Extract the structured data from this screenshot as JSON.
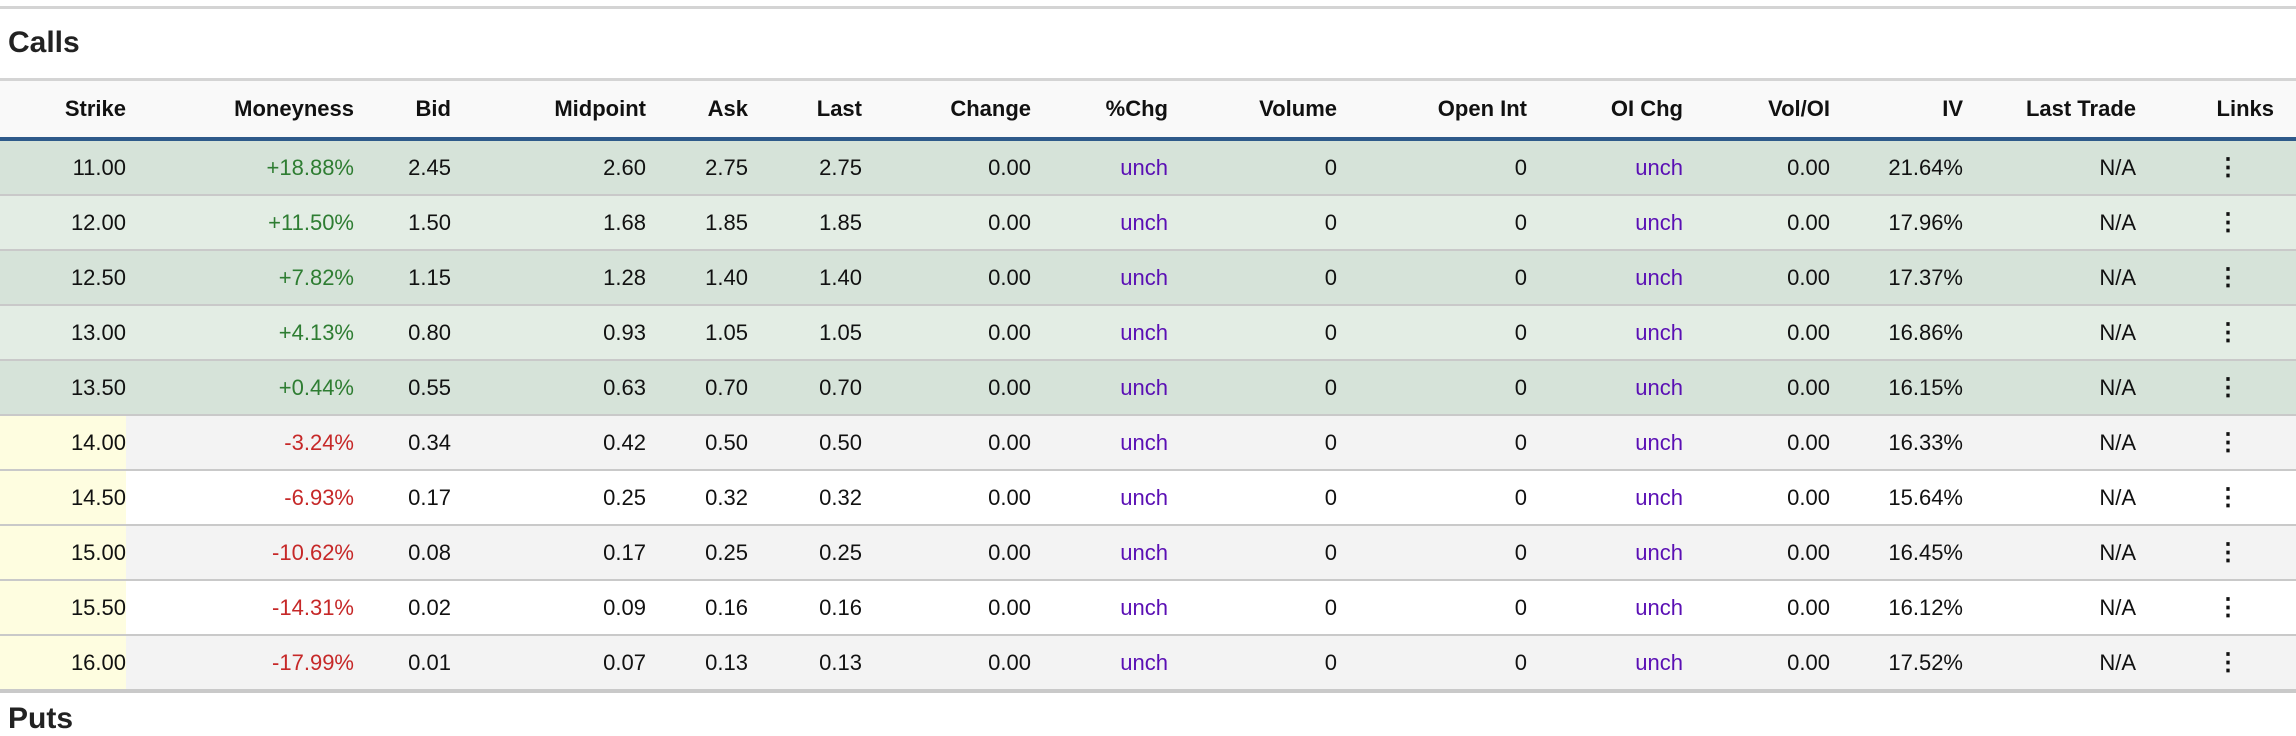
{
  "section_title": "Calls",
  "next_section_title": "Puts",
  "columns": [
    "Strike",
    "Moneyness",
    "Bid",
    "Midpoint",
    "Ask",
    "Last",
    "Change",
    "%Chg",
    "Volume",
    "Open Int",
    "OI Chg",
    "Vol/OI",
    "IV",
    "Last Trade",
    "Links"
  ],
  "rows": [
    {
      "strike": "11.00",
      "moneyness": "+18.88%",
      "bid": "2.45",
      "mid": "2.60",
      "ask": "2.75",
      "last": "2.75",
      "change": "0.00",
      "pchg": "unch",
      "volume": "0",
      "oi": "0",
      "oichg": "unch",
      "voloi": "0.00",
      "iv": "21.64%",
      "last_trade": "N/A",
      "itm": true
    },
    {
      "strike": "12.00",
      "moneyness": "+11.50%",
      "bid": "1.50",
      "mid": "1.68",
      "ask": "1.85",
      "last": "1.85",
      "change": "0.00",
      "pchg": "unch",
      "volume": "0",
      "oi": "0",
      "oichg": "unch",
      "voloi": "0.00",
      "iv": "17.96%",
      "last_trade": "N/A",
      "itm": true
    },
    {
      "strike": "12.50",
      "moneyness": "+7.82%",
      "bid": "1.15",
      "mid": "1.28",
      "ask": "1.40",
      "last": "1.40",
      "change": "0.00",
      "pchg": "unch",
      "volume": "0",
      "oi": "0",
      "oichg": "unch",
      "voloi": "0.00",
      "iv": "17.37%",
      "last_trade": "N/A",
      "itm": true
    },
    {
      "strike": "13.00",
      "moneyness": "+4.13%",
      "bid": "0.80",
      "mid": "0.93",
      "ask": "1.05",
      "last": "1.05",
      "change": "0.00",
      "pchg": "unch",
      "volume": "0",
      "oi": "0",
      "oichg": "unch",
      "voloi": "0.00",
      "iv": "16.86%",
      "last_trade": "N/A",
      "itm": true
    },
    {
      "strike": "13.50",
      "moneyness": "+0.44%",
      "bid": "0.55",
      "mid": "0.63",
      "ask": "0.70",
      "last": "0.70",
      "change": "0.00",
      "pchg": "unch",
      "volume": "0",
      "oi": "0",
      "oichg": "unch",
      "voloi": "0.00",
      "iv": "16.15%",
      "last_trade": "N/A",
      "itm": true
    },
    {
      "strike": "14.00",
      "moneyness": "-3.24%",
      "bid": "0.34",
      "mid": "0.42",
      "ask": "0.50",
      "last": "0.50",
      "change": "0.00",
      "pchg": "unch",
      "volume": "0",
      "oi": "0",
      "oichg": "unch",
      "voloi": "0.00",
      "iv": "16.33%",
      "last_trade": "N/A",
      "itm": false
    },
    {
      "strike": "14.50",
      "moneyness": "-6.93%",
      "bid": "0.17",
      "mid": "0.25",
      "ask": "0.32",
      "last": "0.32",
      "change": "0.00",
      "pchg": "unch",
      "volume": "0",
      "oi": "0",
      "oichg": "unch",
      "voloi": "0.00",
      "iv": "15.64%",
      "last_trade": "N/A",
      "itm": false
    },
    {
      "strike": "15.00",
      "moneyness": "-10.62%",
      "bid": "0.08",
      "mid": "0.17",
      "ask": "0.25",
      "last": "0.25",
      "change": "0.00",
      "pchg": "unch",
      "volume": "0",
      "oi": "0",
      "oichg": "unch",
      "voloi": "0.00",
      "iv": "16.45%",
      "last_trade": "N/A",
      "itm": false
    },
    {
      "strike": "15.50",
      "moneyness": "-14.31%",
      "bid": "0.02",
      "mid": "0.09",
      "ask": "0.16",
      "last": "0.16",
      "change": "0.00",
      "pchg": "unch",
      "volume": "0",
      "oi": "0",
      "oichg": "unch",
      "voloi": "0.00",
      "iv": "16.12%",
      "last_trade": "N/A",
      "itm": false
    },
    {
      "strike": "16.00",
      "moneyness": "-17.99%",
      "bid": "0.01",
      "mid": "0.07",
      "ask": "0.13",
      "last": "0.13",
      "change": "0.00",
      "pchg": "unch",
      "volume": "0",
      "oi": "0",
      "oichg": "unch",
      "voloi": "0.00",
      "iv": "17.52%",
      "last_trade": "N/A",
      "itm": false
    }
  ],
  "links_icon": "more-vertical-icon",
  "links_glyph": "⋮",
  "colors": {
    "header_border": "#2e5a8a",
    "positive": "#2e7d32",
    "negative": "#c62828",
    "unch": "#5a0fb4",
    "itm_bg": "#d6e3d9",
    "otm_strike_bg": "#fefde0"
  }
}
